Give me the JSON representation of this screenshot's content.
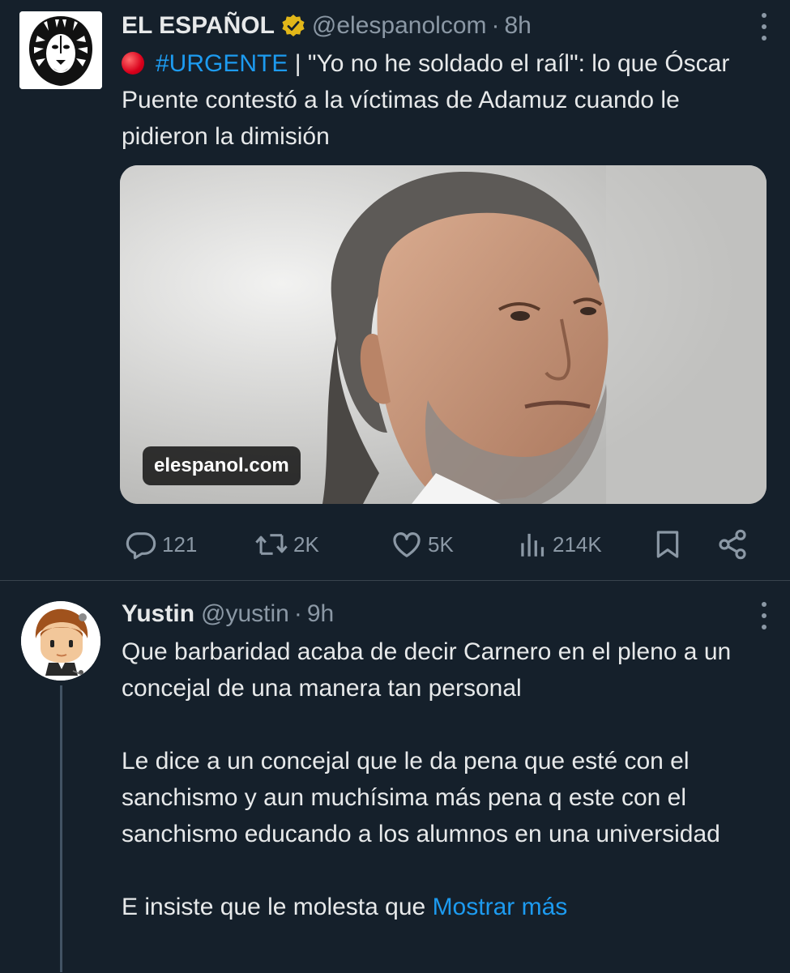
{
  "tweets": [
    {
      "author": "EL ESPAÑOL",
      "handle": "@elespanolcom",
      "separator": "·",
      "time": "8h",
      "hashtag": "#URGENTE",
      "text": " | \"Yo no he soldado el raíl\": lo que Óscar Puente contestó a la víctimas de Adamuz cuando le pidieron la dimisión",
      "media_source": "elespanol.com",
      "counts": {
        "replies": "121",
        "reposts": "2K",
        "likes": "5K",
        "views": "214K"
      }
    },
    {
      "author": "Yustin",
      "handle": "@yustin",
      "separator": "·",
      "time": "9h",
      "paragraphs": [
        "Que barbaridad acaba de decir Carnero en el pleno a un concejal de una manera tan personal",
        "Le dice a un concejal que le da pena que esté con el sanchismo y aun muchísima más pena q este con el sanchismo educando a los alumnos en una universidad",
        "E insiste que le molesta que "
      ],
      "show_more": "Mostrar más"
    }
  ],
  "colors": {
    "background": "#15202b",
    "text": "#e7e9ea",
    "secondary": "#8b98a5",
    "accent": "#1d9bf0",
    "verified": "#e2b719",
    "divider": "#38444d"
  },
  "icons": {
    "verified": "gold-verified-badge",
    "urgent": "red-circle-emoji",
    "reply": "speech-bubble-icon",
    "repost": "repost-arrows-icon",
    "like": "heart-icon",
    "views": "bar-chart-icon",
    "bookmark": "bookmark-icon",
    "share": "share-icon",
    "more": "vertical-dots-icon"
  }
}
